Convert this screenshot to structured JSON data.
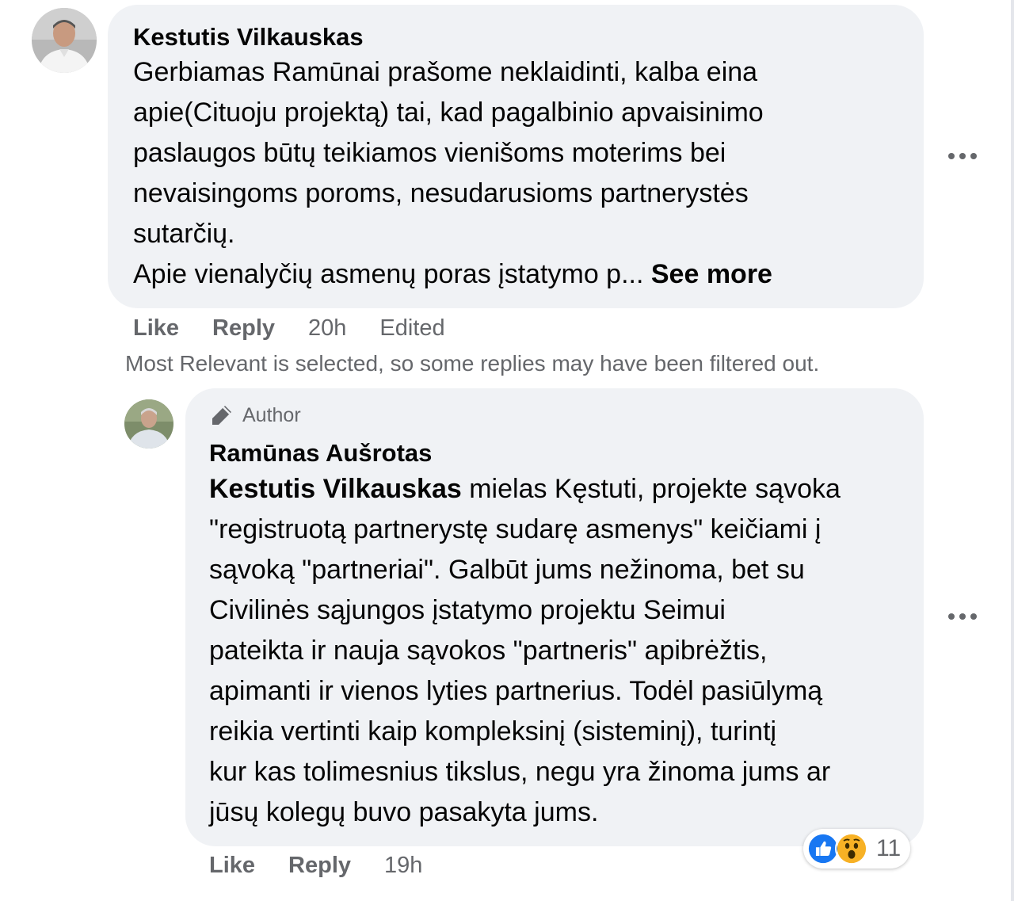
{
  "comment": {
    "author": "Kestutis Vilkauskas",
    "text_lines": [
      "Gerbiamas Ramūnai prašome neklaidinti, kalba eina",
      "apie(Cituoju projektą) tai, kad pagalbinio apvaisinimo",
      "paslaugos būtų teikiamos vienišoms moterims bei",
      "nevaisingoms poroms, nesudarusioms partnerystės",
      "sutarčių."
    ],
    "last_line": "Apie vienalyčių asmenų poras įstatymo p... ",
    "see_more": "See more",
    "actions": {
      "like": "Like",
      "reply": "Reply",
      "time": "20h",
      "edited": "Edited"
    }
  },
  "filter_notice": "Most Relevant is selected, so some replies may have been filtered out.",
  "reply": {
    "badge": "Author",
    "author": "Ramūnas Aušrotas",
    "mention": "Kestutis Vilkauskas",
    "first_line_rest": " mielas Kęstuti, projekte sąvoka",
    "text_lines": [
      "\"registruotą partnerystę sudarę asmenys\" keičiami į",
      "sąvoką \"partneriai\". Galbūt jums nežinoma, bet su",
      "Civilinės sąjungos įstatymo projektu Seimui",
      "pateikta ir nauja sąvokos \"partneris\" apibrėžtis,",
      "apimanti ir vienos lyties partnerius. Todėl pasiūlymą",
      "reikia vertinti kaip kompleksinį (sisteminį), turintį",
      "kur kas tolimesnius tikslus, negu yra žinoma jums ar",
      "jūsų kolegų buvo pasakyta jums."
    ],
    "actions": {
      "like": "Like",
      "reply": "Reply",
      "time": "19h"
    },
    "reactions": {
      "icons": [
        "like-reaction-icon",
        "wow-reaction-icon"
      ],
      "count": "11"
    }
  },
  "colors": {
    "bubble": "#f0f2f5",
    "secondary_text": "#65676b",
    "like_blue": "#1877f2",
    "wow_yellow": "#f7b125"
  }
}
